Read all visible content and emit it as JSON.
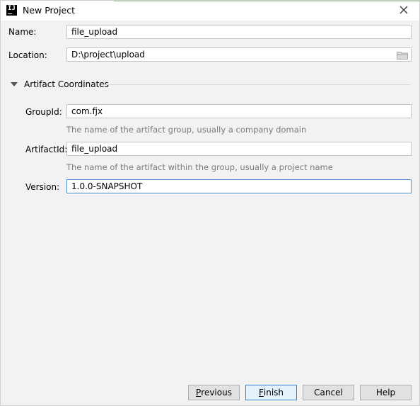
{
  "window": {
    "title": "New Project",
    "icon": "intellij-idea-icon"
  },
  "form": {
    "name": {
      "label": "Name:",
      "value": "file_upload"
    },
    "location": {
      "label": "Location:",
      "value": "D:\\project\\upload"
    }
  },
  "artifact": {
    "section_title": "Artifact Coordinates",
    "group_id": {
      "label": "GroupId:",
      "value": "com.fjx",
      "hint": "The name of the artifact group, usually a company domain"
    },
    "artifact_id": {
      "label": "ArtifactId:",
      "value": "file_upload",
      "hint": "The name of the artifact within the group, usually a project name"
    },
    "version": {
      "label": "Version:",
      "value": "1.0.0-SNAPSHOT"
    }
  },
  "buttons": {
    "previous": {
      "mnemonic": "P",
      "rest": "revious"
    },
    "finish": {
      "mnemonic": "F",
      "rest": "inish"
    },
    "cancel": "Cancel",
    "help": "Help"
  },
  "colors": {
    "focus_border": "#4e8ed2",
    "default_button_border": "#3c7fd1",
    "background": "#f2f2f2"
  }
}
